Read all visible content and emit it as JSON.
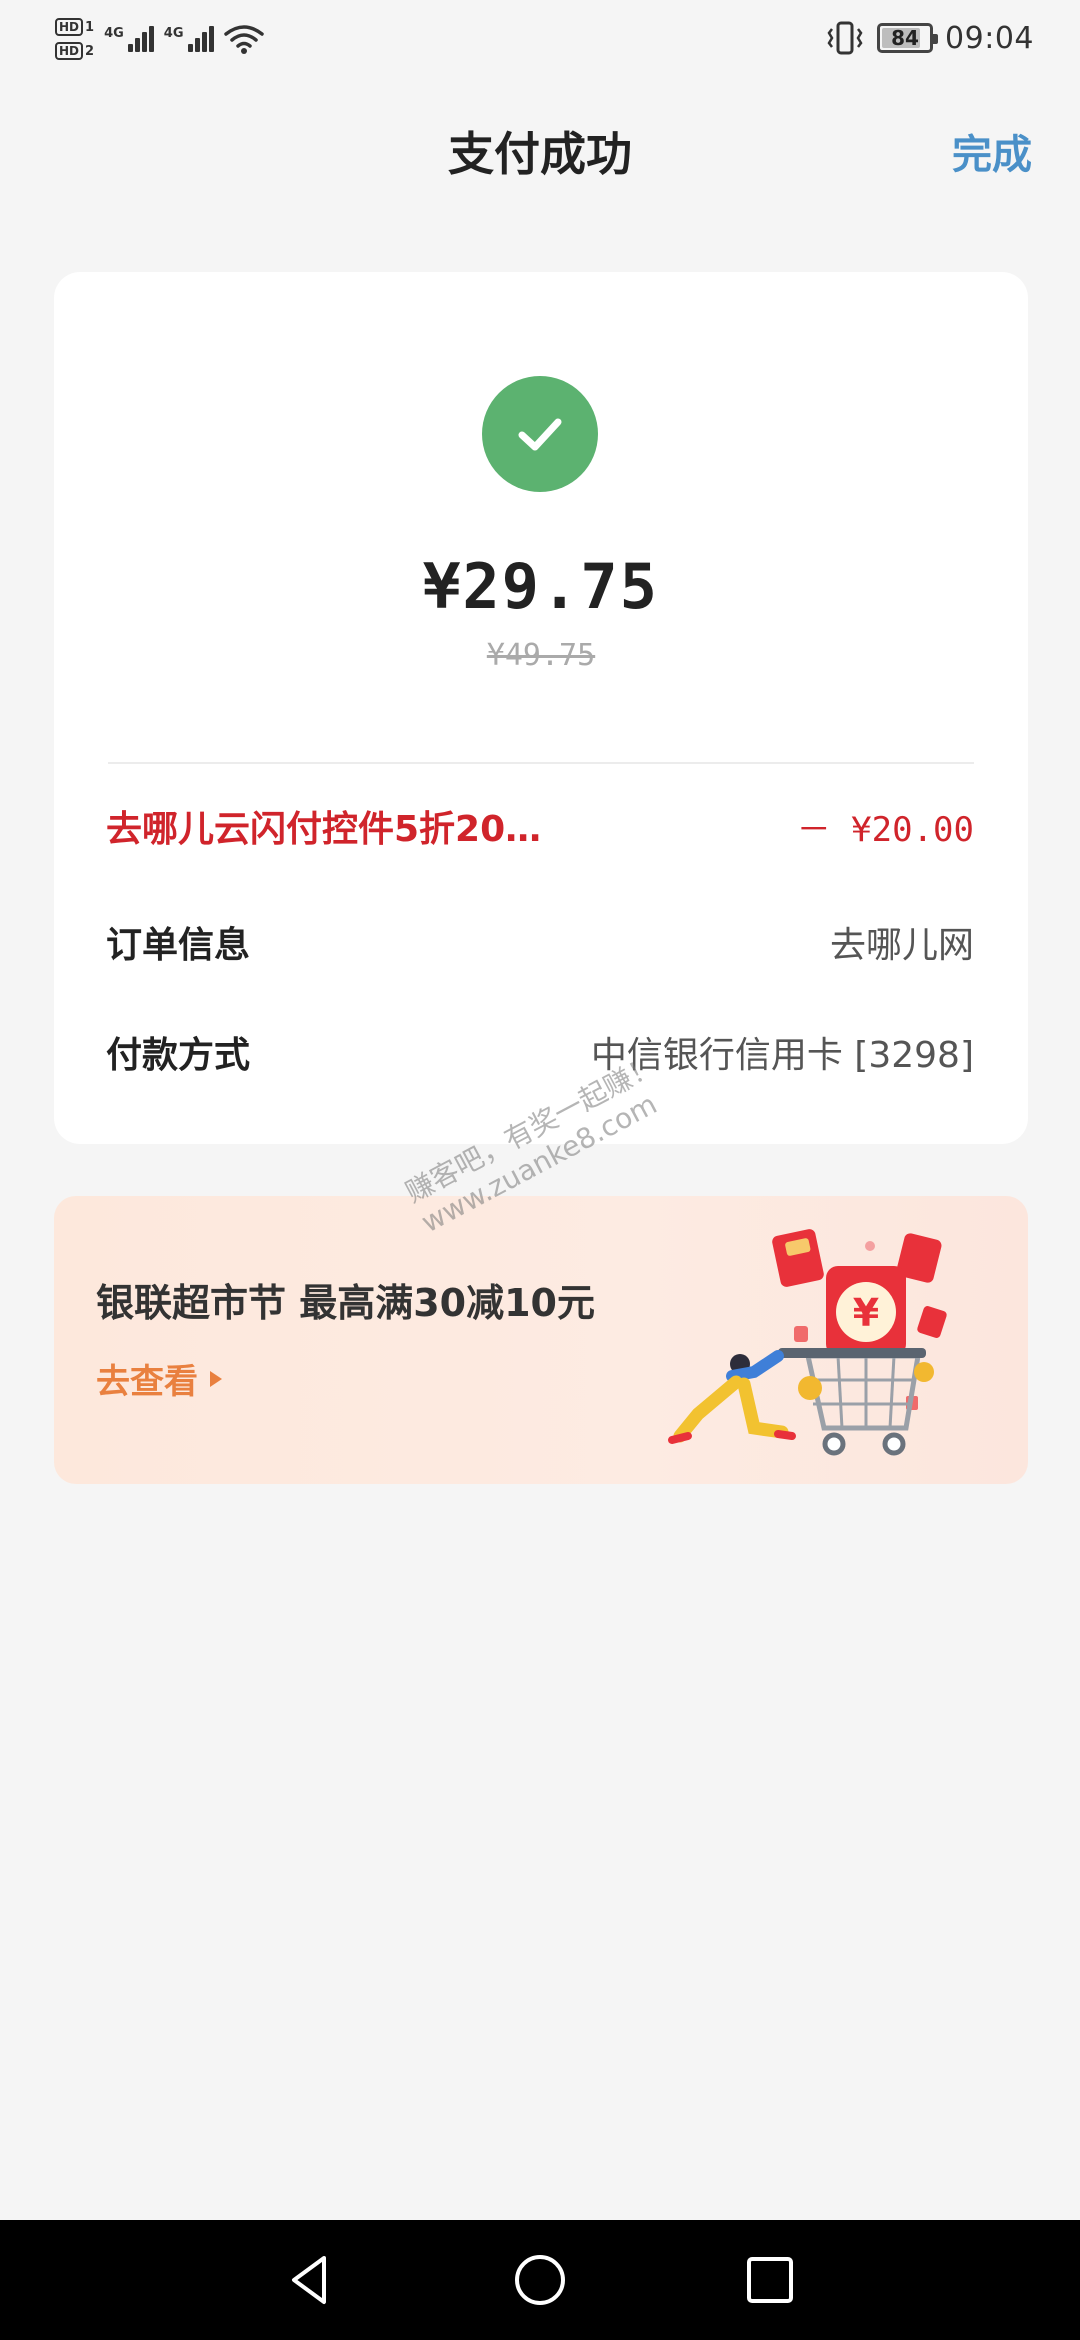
{
  "status_bar": {
    "hd1": "HD",
    "hd1_sub": "1",
    "hd2": "HD",
    "hd2_sub": "2",
    "net1": "4G",
    "net2": "4G",
    "battery_level": "84",
    "time": "09:04",
    "icons": [
      "hd-icon",
      "signal-icon",
      "wifi-icon",
      "vibrate-icon",
      "battery-icon"
    ]
  },
  "header": {
    "title": "支付成功",
    "done_label": "完成"
  },
  "payment": {
    "status_icon": "check-icon",
    "amount": "¥29.75",
    "original_amount": "¥49.75",
    "discount": {
      "label": "去哪儿云闪付控件5折20…",
      "value": "－ ¥20.00"
    },
    "order_info": {
      "label": "订单信息",
      "value": "去哪儿网"
    },
    "payment_method": {
      "label": "付款方式",
      "value": "中信银行信用卡 [3298]"
    }
  },
  "promo": {
    "title": "银联超市节 最高满30减10元",
    "link_label": "去查看"
  },
  "watermark": {
    "line1": "赚客吧，有奖一起赚！",
    "line2": "www.zuanke8.com"
  },
  "colors": {
    "accent_link": "#4a90c8",
    "success_green": "#5cb270",
    "discount_red": "#d0242b",
    "promo_orange": "#e9803f"
  }
}
